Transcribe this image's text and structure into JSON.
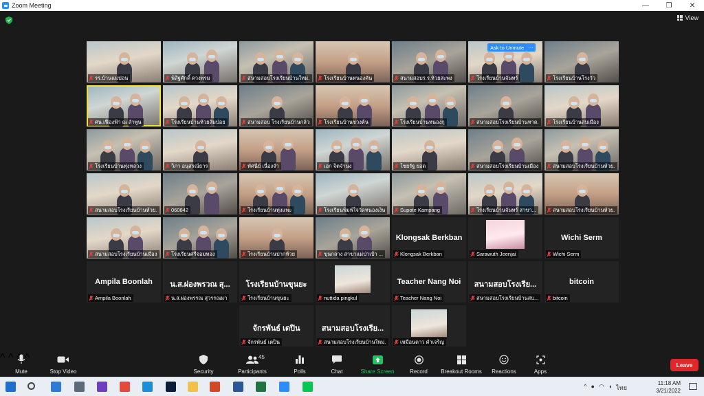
{
  "window": {
    "title": "Zoom Meeting",
    "controls": [
      "—",
      "❐",
      "✕"
    ]
  },
  "view_label": "View",
  "ask_unmute_label": "Ask to Unmute",
  "ask_unmute_more": "···",
  "tiles": [
    {
      "label": "รร.บ้านแม่ปอน",
      "kind": "video",
      "style": "v2"
    },
    {
      "label": "พิสิฐศักดิ์ ดวงพรม",
      "kind": "video",
      "style": "v5"
    },
    {
      "label": "สนามสอบโรงเรียนบ้านใหม่...",
      "kind": "video",
      "style": "v1"
    },
    {
      "label": "โรงเรียนบ้านหนองคัน",
      "kind": "video",
      "style": "v4"
    },
    {
      "label": "สนามสอบร.ร.ห้วยสะพง",
      "kind": "video",
      "style": "v3"
    },
    {
      "label": "โรงเรียนบ้านจันทร์",
      "kind": "video",
      "style": "v2",
      "unmute": true
    },
    {
      "label": "โรงเรียนบ้านโรงวัว",
      "kind": "video",
      "style": "v3"
    },
    {
      "label": "ศน.เฟื่องฟ้า ณ ลำพูน",
      "kind": "video",
      "style": "v5",
      "active": true
    },
    {
      "label": "โรงเรียนบ้านห้วยส้มป่อย",
      "kind": "video",
      "style": "v2"
    },
    {
      "label": "สนามสอบ โรงเรียนบ้านกล้วย",
      "kind": "video",
      "style": "v3"
    },
    {
      "label": "โรงเรียนบ้านข่วงต้น",
      "kind": "video",
      "style": "v4"
    },
    {
      "label": "โรงเรียนบ้านหนองกุ",
      "kind": "video",
      "style": "v1"
    },
    {
      "label": "สนามสอบโรงเรียนบ้านหาด...",
      "kind": "video",
      "style": "v3"
    },
    {
      "label": "โรงเรียนบ้านสบเมือง",
      "kind": "video",
      "style": "v2"
    },
    {
      "label": "โรงเรียนบ้านทุ่งหลวง",
      "kind": "video",
      "style": "v1"
    },
    {
      "label": "วิภา อนุสรณ์ธาร",
      "kind": "video",
      "style": "v2"
    },
    {
      "label": "ทัศนีย์ เนื่องจำ",
      "kind": "video",
      "style": "v4"
    },
    {
      "label": "เอก จิตจำนง",
      "kind": "video",
      "style": "v5"
    },
    {
      "label": "ไชยรัฐ ยอด",
      "kind": "video",
      "style": "v2"
    },
    {
      "label": "สนามสอบโรงเรียนบ้านเมือง...",
      "kind": "video",
      "style": "v3"
    },
    {
      "label": "สนามสอบโรงเรียนบ้านห้วย...",
      "kind": "video",
      "style": "v1"
    },
    {
      "label": "สนามสอบโรงเรียนบ้านห้วย...",
      "kind": "video",
      "style": "v2"
    },
    {
      "label": "060842",
      "kind": "video",
      "style": "v3"
    },
    {
      "label": "โรงเรียนบ้านทุ่งแพะ",
      "kind": "video",
      "style": "v4"
    },
    {
      "label": "โรงเรียนพิมพ์ใจวัดหนองเงิน",
      "kind": "video",
      "style": "v5"
    },
    {
      "label": "Supote Kampang",
      "kind": "video",
      "style": "v1"
    },
    {
      "label": "โรงเรียนบ้านจันทร์ สาขา...",
      "kind": "video",
      "style": "v2"
    },
    {
      "label": "สนามสอบโรงเรียนบ้านห้วย...",
      "kind": "video",
      "style": "v4"
    },
    {
      "label": "สนามสอบโรงเรียนบ้านเมือง...",
      "kind": "video",
      "style": "v2"
    },
    {
      "label": "โรงเรียนศรีจอมทอง",
      "kind": "video",
      "style": "v3"
    },
    {
      "label": "โรงเรียนบ้านปากห้วย",
      "kind": "video",
      "style": "v4"
    },
    {
      "label": "ขุนกลาง สาขาแม่ป่าเป้า ...",
      "kind": "video",
      "style": "v3"
    },
    {
      "label": "Klongsak Berkban",
      "kind": "name",
      "display": "Klongsak Berkban"
    },
    {
      "label": "Sarawuth Jeenjai",
      "kind": "thumb",
      "thumb": "pink"
    },
    {
      "label": "Wichi Serm",
      "kind": "name",
      "display": "Wichi Serm"
    },
    {
      "label": "Ampila Boonlah",
      "kind": "name",
      "display": "Ampila Boonlah"
    },
    {
      "label": "น.ส.ผ่องพรรณ สุวรรณมา",
      "kind": "name",
      "display": "น.ส.ผ่องพรวณ สุ..."
    },
    {
      "label": "โรงเรียนบ้านขุนยะ",
      "kind": "name",
      "display": "โรงเรียนบ้านขุนยะ"
    },
    {
      "label": "nuttida pingkul",
      "kind": "thumb",
      "thumb": "plain"
    },
    {
      "label": "Teacher Nang Noi",
      "kind": "name",
      "display": "Teacher Nang Noi"
    },
    {
      "label": "สนามสอบโรงเรียนบ้านสบ...",
      "kind": "name",
      "display": "สนามสอบโรงเรีย..."
    },
    {
      "label": "bitcoin",
      "kind": "name",
      "display": "bitcoin"
    },
    {
      "label": "",
      "kind": "empty"
    },
    {
      "label": "",
      "kind": "empty"
    },
    {
      "label": "จักรพันธ์ เตปิน",
      "kind": "name",
      "display": "จักรพันธ์ เตปิน"
    },
    {
      "label": "สนามสอบโรงเรียนบ้านใหม่...",
      "kind": "name",
      "display": "สนามสอบโรงเรีย..."
    },
    {
      "label": "เหมือนดาว คำเจริญ",
      "kind": "thumb",
      "thumb": "plain"
    }
  ],
  "toolbar": {
    "mute": "Mute",
    "stop_video": "Stop Video",
    "security": "Security",
    "participants": "Participants",
    "participants_count": "45",
    "polls": "Polls",
    "chat": "Chat",
    "share_screen": "Share Screen",
    "record": "Record",
    "breakout_rooms": "Breakout Rooms",
    "reactions": "Reactions",
    "apps": "Apps",
    "leave": "Leave"
  },
  "taskbar": {
    "time": "11:18 AM",
    "date": "3/21/2022",
    "lang": "ไทย",
    "apps": [
      {
        "name": "windows-start-icon",
        "color": "#1f6fd0"
      },
      {
        "name": "search-icon",
        "color": "#444444"
      },
      {
        "name": "mail-icon",
        "color": "#2f7ad6"
      },
      {
        "name": "calculator-icon",
        "color": "#5b6b7a"
      },
      {
        "name": "visual-studio-icon",
        "color": "#6d3fc0"
      },
      {
        "name": "chrome-icon",
        "color": "#e6493a"
      },
      {
        "name": "edge-icon",
        "color": "#1a8fd8"
      },
      {
        "name": "photoshop-icon",
        "color": "#0b1d3a"
      },
      {
        "name": "file-explorer-icon",
        "color": "#f2c14a"
      },
      {
        "name": "powerpoint-icon",
        "color": "#d24726"
      },
      {
        "name": "word-icon",
        "color": "#2b579a"
      },
      {
        "name": "excel-icon",
        "color": "#217346"
      },
      {
        "name": "zoom-icon",
        "color": "#2d8cff"
      },
      {
        "name": "line-icon",
        "color": "#06c755"
      }
    ]
  }
}
